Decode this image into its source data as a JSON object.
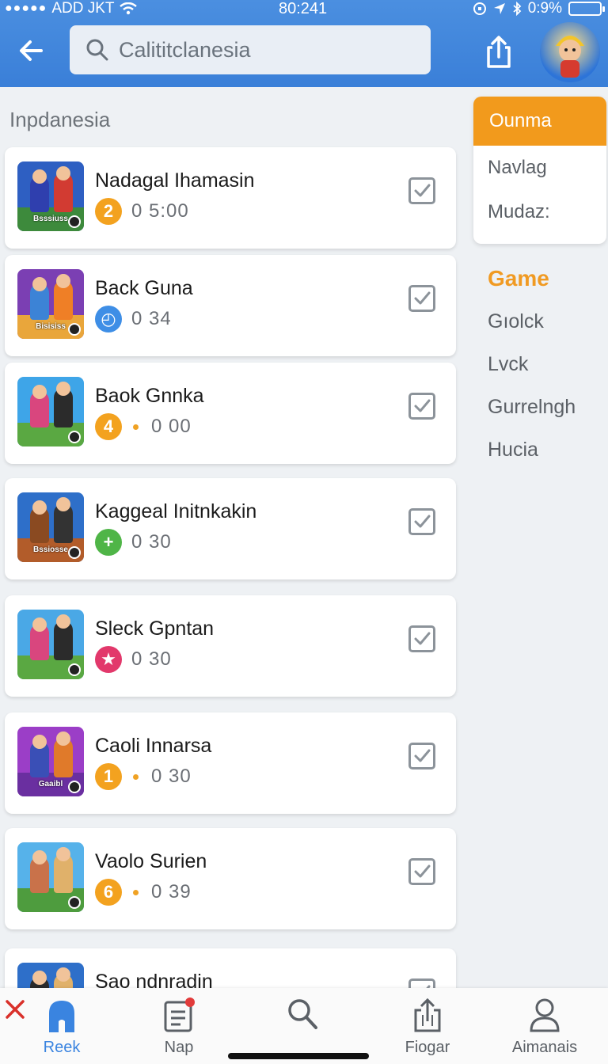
{
  "status_bar": {
    "carrier": "ADD JKT",
    "time": "80:241",
    "battery": "0:9%"
  },
  "header": {
    "search": {
      "value": "Calititclanesia",
      "placeholder": "Calititclanesia"
    }
  },
  "section_title": "Inpdanesia",
  "games": [
    {
      "title": "Nadagal Ihamasin",
      "badge": "2",
      "badge_color": "#f3a21f",
      "meta": "0  5:00",
      "has_dot": false,
      "thumb_label": "Bsssiuss",
      "sky": "#2e5fc2",
      "ground": "#3d8a3c",
      "c1": "#2f3fae",
      "c2": "#d23b32"
    },
    {
      "title": "Back Guna",
      "badge": "◴",
      "badge_color": "#3e8ee6",
      "meta": "0  34",
      "has_dot": false,
      "thumb_label": "Bisisiss",
      "sky": "#7b3fb3",
      "ground": "#e9a63b",
      "c1": "#3c83d6",
      "c2": "#ef7f26"
    },
    {
      "title": "Baok Gnnka",
      "badge": "4",
      "badge_color": "#f3a21f",
      "meta": "0 00",
      "has_dot": true,
      "thumb_label": "",
      "sky": "#3ea5e8",
      "ground": "#5aa842",
      "c1": "#d9467e",
      "c2": "#2b2b2b"
    },
    {
      "title": "Kaggeal Initnkakin",
      "badge": "+",
      "badge_color": "#4fb547",
      "meta": "0  30",
      "has_dot": false,
      "thumb_label": "Bssiosse",
      "sky": "#2e6fc9",
      "ground": "#b25c2a",
      "c1": "#8a4a21",
      "c2": "#333333"
    },
    {
      "title": "Sleck Gpntan",
      "badge": "★",
      "badge_color": "#e2386b",
      "meta": "0  30",
      "has_dot": false,
      "thumb_label": "",
      "sky": "#4aa8e6",
      "ground": "#5aa842",
      "c1": "#d9467e",
      "c2": "#2b2b2b"
    },
    {
      "title": "Caoli Innarsa",
      "badge": "1",
      "badge_color": "#f3a21f",
      "meta": "0 30",
      "has_dot": true,
      "thumb_label": "Gaaibl",
      "sky": "#9b3ec7",
      "ground": "#6a2fa0",
      "c1": "#3a4fb6",
      "c2": "#e07a2a"
    },
    {
      "title": "Vaolo Surien",
      "badge": "6",
      "badge_color": "#f3a21f",
      "meta": "0 39",
      "has_dot": true,
      "thumb_label": "",
      "sky": "#56b2ea",
      "ground": "#4e9c3e",
      "c1": "#c9724a",
      "c2": "#e0b16a"
    },
    {
      "title": "Sao ndnradin",
      "badge": "",
      "badge_color": "#f3a21f",
      "meta": "",
      "has_dot": false,
      "thumb_label": "",
      "sky": "#2e6fc9",
      "ground": "#f2c13a",
      "c1": "#2b2b2b",
      "c2": "#e0b16a"
    }
  ],
  "filter": {
    "active": "Ounma",
    "items": [
      "Navlag",
      "Mudaz:"
    ]
  },
  "categories": {
    "title": "Game",
    "items": [
      "Gıolck",
      "Lvck",
      "Gurrelngh",
      "Hucia"
    ]
  },
  "bottom_nav": [
    {
      "label": "Reek",
      "icon": "home-icon",
      "active": true
    },
    {
      "label": "Nap",
      "icon": "news-icon",
      "active": false
    },
    {
      "label": "",
      "icon": "search-icon",
      "active": false
    },
    {
      "label": "Fiogar",
      "icon": "share-icon",
      "active": false
    },
    {
      "label": "Aimanais",
      "icon": "profile-icon",
      "active": false
    }
  ],
  "colors": {
    "accent": "#3a84e0",
    "orange": "#f29a1c",
    "header": "#4b8fe0"
  }
}
